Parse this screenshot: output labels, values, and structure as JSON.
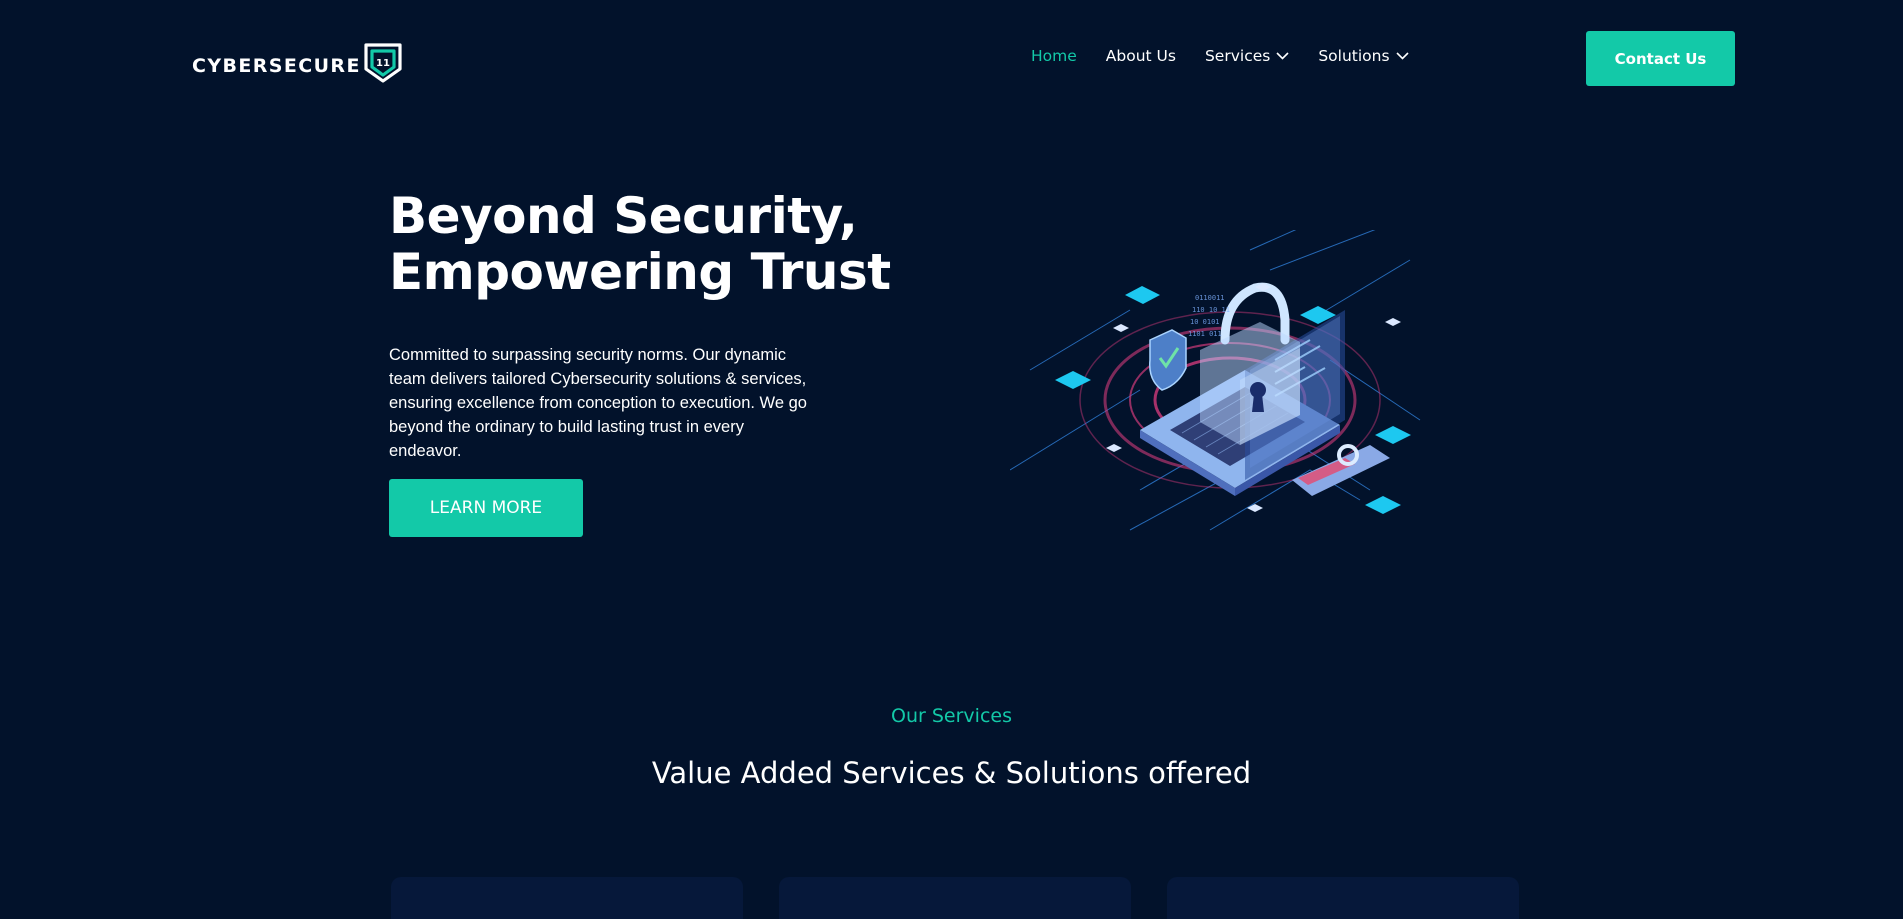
{
  "brand": {
    "name": "CYBERSECURE",
    "badge": "11",
    "accent_color": "#13c9a8",
    "background_color": "#02122b"
  },
  "nav": {
    "items": [
      {
        "label": "Home",
        "active": true,
        "dropdown": false
      },
      {
        "label": "About Us",
        "active": false,
        "dropdown": false
      },
      {
        "label": "Services",
        "active": false,
        "dropdown": true
      },
      {
        "label": "Solutions",
        "active": false,
        "dropdown": true
      }
    ],
    "contact_label": "Contact Us"
  },
  "hero": {
    "title_line1": "Beyond Security,",
    "title_line2": "Empowering Trust",
    "description": "Committed to surpassing security norms. Our dynamic team delivers tailored Cybersecurity solutions & services, ensuring excellence from conception to execution. We go beyond the ordinary to build lasting trust in every endeavor.",
    "cta_label": "LEARN MORE",
    "illustration_icon": "laptop-padlock-security-illustration"
  },
  "services": {
    "eyebrow": "Our Services",
    "title": "Value Added Services & Solutions offered"
  }
}
